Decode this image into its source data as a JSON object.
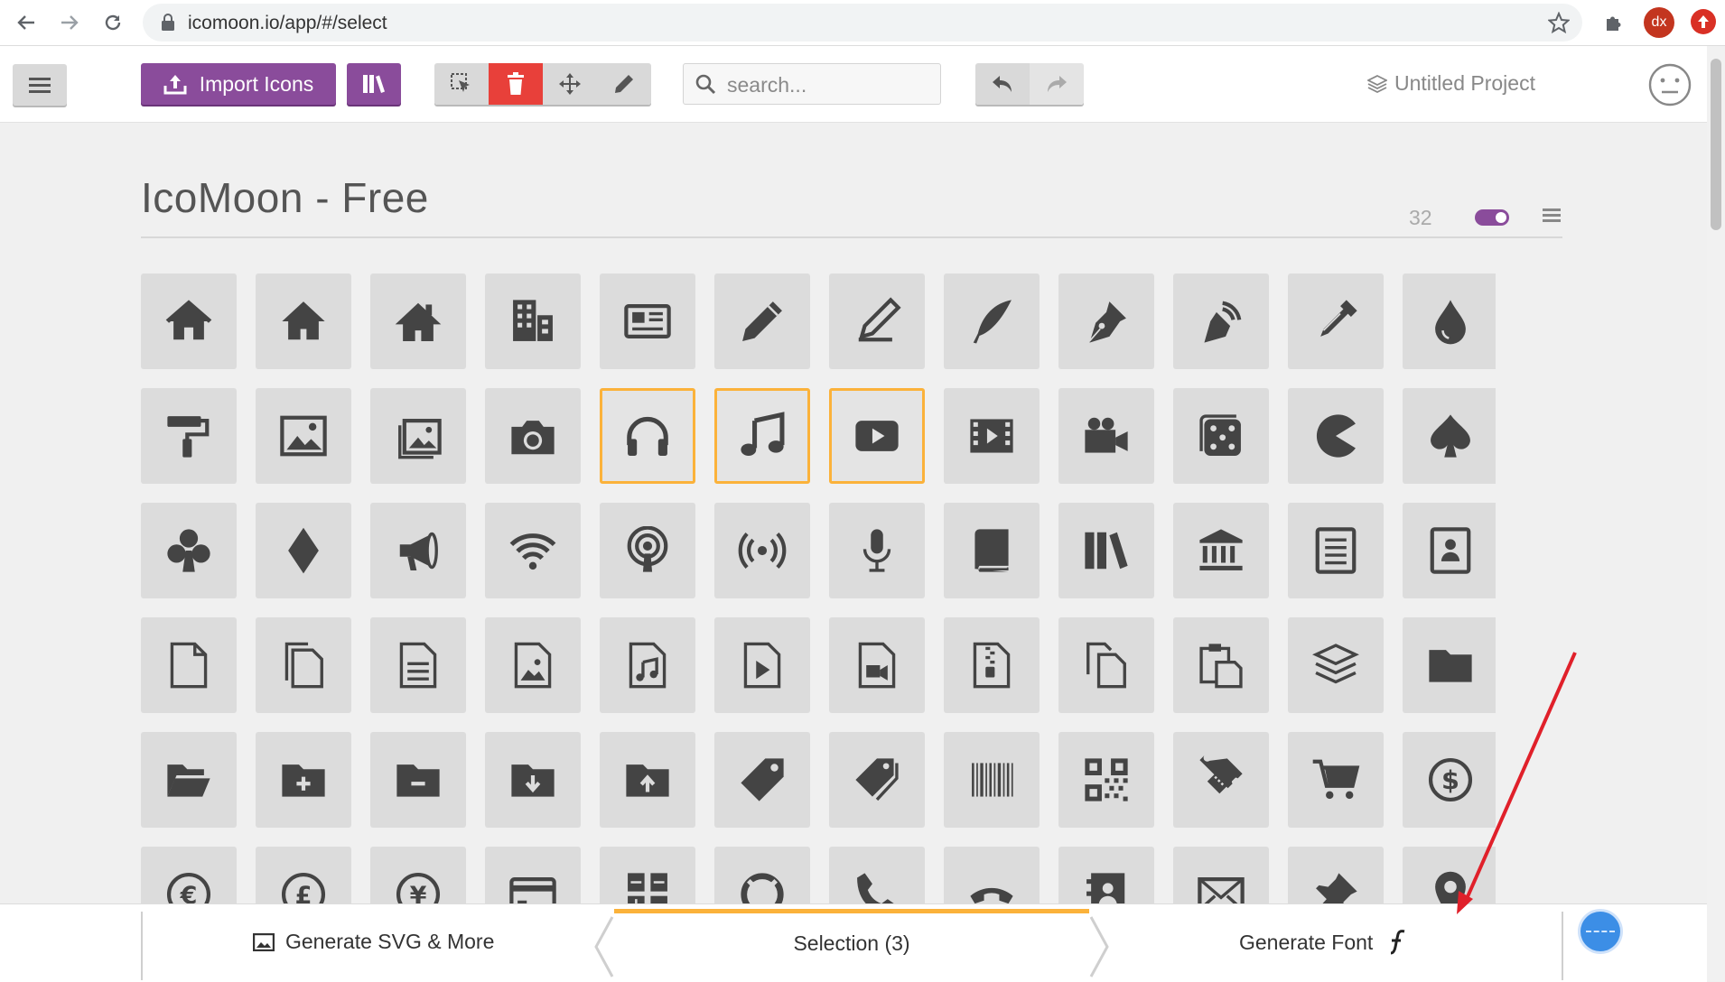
{
  "browser": {
    "url": "icomoon.io/app/#/select",
    "profile_initials": "dx"
  },
  "toolbar": {
    "import_label": "Import Icons",
    "search_placeholder": "search...",
    "project_name": "Untitled Project"
  },
  "icon_set": {
    "title": "IcoMoon - Free",
    "grid_size": "32"
  },
  "icons": [
    [
      "home",
      "home2",
      "home3",
      "office",
      "newspaper",
      "pencil",
      "pencil2",
      "quill",
      "pen",
      "blog",
      "eyedropper",
      "droplet"
    ],
    [
      "paint-format",
      "image",
      "images",
      "camera",
      "headphones",
      "music",
      "play",
      "film",
      "video-camera",
      "dice",
      "pacman",
      "spades"
    ],
    [
      "clubs",
      "diamonds",
      "bullhorn",
      "connection",
      "podcast",
      "feed",
      "mic",
      "book",
      "books",
      "library",
      "file-text",
      "profile"
    ],
    [
      "file-empty",
      "files-empty",
      "file-text2",
      "file-picture",
      "file-music",
      "file-play",
      "file-video",
      "file-zip",
      "copy",
      "paste",
      "stack",
      "folder"
    ],
    [
      "folder-open",
      "folder-plus",
      "folder-minus",
      "folder-download",
      "folder-upload",
      "price-tag",
      "price-tags",
      "barcode",
      "qrcode",
      "ticket",
      "cart",
      "coin-dollar"
    ],
    [
      "coin-euro",
      "coin-pound",
      "coin-yen",
      "credit-card",
      "calculator",
      "lifebuoy",
      "phone",
      "phone-hang-up",
      "address-book",
      "envelop",
      "pushpin",
      "location"
    ]
  ],
  "selected_icons": [
    "headphones",
    "music",
    "play"
  ],
  "bottom_bar": {
    "generate_svg_label": "Generate SVG & More",
    "selection_label": "Selection (3)",
    "generate_font_label": "Generate Font"
  },
  "colors": {
    "accent_purple": "#8a4c9b",
    "delete_red": "#e8403a",
    "selection_orange": "#fbb23a",
    "annotation_arrow": "#e0202a"
  }
}
